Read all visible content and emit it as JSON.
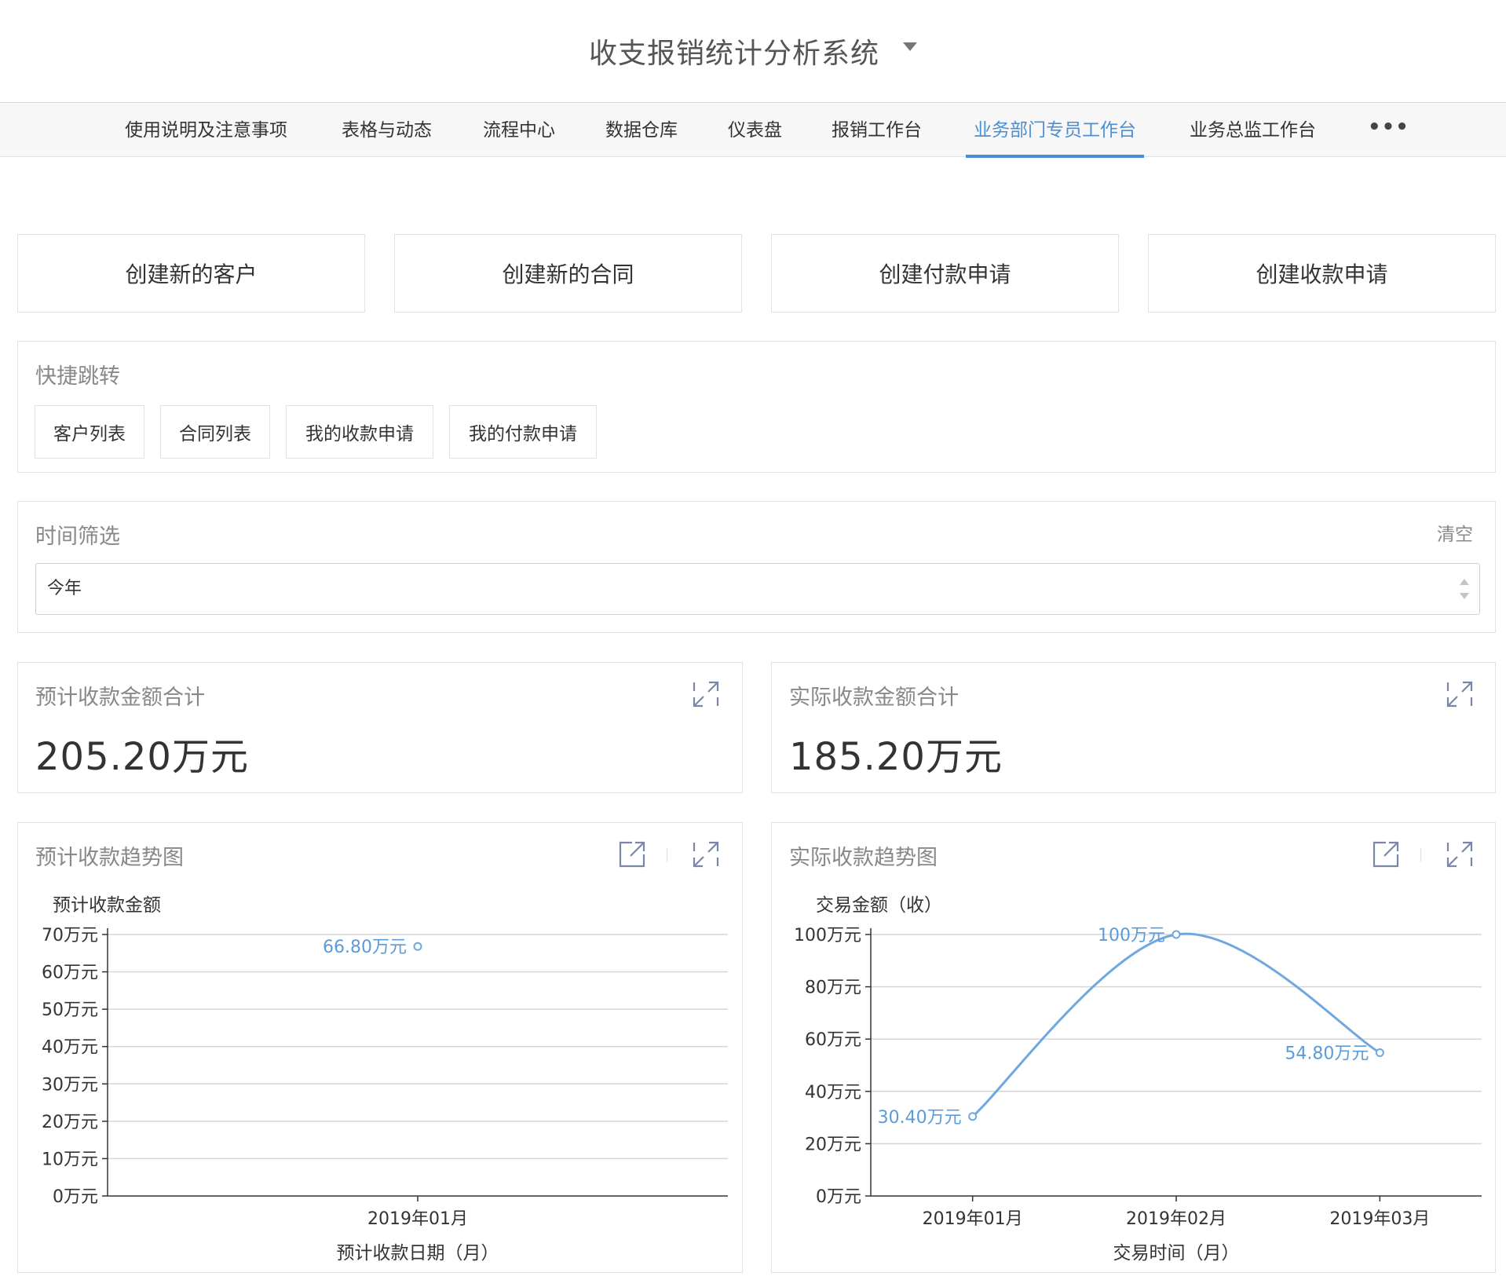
{
  "app": {
    "title": "收支报销统计分析系统"
  },
  "nav": {
    "items": [
      {
        "label": "使用说明及注意事项",
        "active": false
      },
      {
        "label": "表格与动态",
        "active": false
      },
      {
        "label": "流程中心",
        "active": false
      },
      {
        "label": "数据仓库",
        "active": false
      },
      {
        "label": "仪表盘",
        "active": false
      },
      {
        "label": "报销工作台",
        "active": false
      },
      {
        "label": "业务部门专员工作台",
        "active": true
      },
      {
        "label": "业务总监工作台",
        "active": false
      }
    ],
    "more_label": "•••"
  },
  "actions": [
    {
      "label": "创建新的客户"
    },
    {
      "label": "创建新的合同"
    },
    {
      "label": "创建付款申请"
    },
    {
      "label": "创建收款申请"
    }
  ],
  "quick_jump": {
    "title": "快捷跳转",
    "buttons": [
      {
        "label": "客户列表"
      },
      {
        "label": "合同列表"
      },
      {
        "label": "我的收款申请"
      },
      {
        "label": "我的付款申请"
      }
    ]
  },
  "time_filter": {
    "title": "时间筛选",
    "clear_label": "清空",
    "selected": "今年"
  },
  "metrics": {
    "expected": {
      "title": "预计收款金额合计",
      "value": "205.20万元"
    },
    "actual": {
      "title": "实际收款金额合计",
      "value": "185.20万元"
    }
  },
  "charts": {
    "expected_title": "预计收款趋势图",
    "actual_title": "实际收款趋势图"
  },
  "colors": {
    "accent": "#4a8fd6",
    "line": "#6fa7df",
    "label": "#5b9bd9"
  },
  "chart_data": [
    {
      "type": "scatter",
      "title": "预计收款趋势图",
      "ylabel": "预计收款金额",
      "xlabel": "预计收款日期（月）",
      "y_unit": "万元",
      "ylim": [
        0,
        70
      ],
      "yticks": [
        0,
        10,
        20,
        30,
        40,
        50,
        60,
        70
      ],
      "ytick_labels": [
        "0万元",
        "10万元",
        "20万元",
        "30万元",
        "40万元",
        "50万元",
        "60万元",
        "70万元"
      ],
      "categories": [
        "2019年01月"
      ],
      "series": [
        {
          "values": [
            66.8
          ],
          "labels": [
            "66.80万元"
          ]
        }
      ],
      "grid": true
    },
    {
      "type": "line",
      "title": "实际收款趋势图",
      "ylabel": "交易金额（收）",
      "xlabel": "交易时间（月）",
      "y_unit": "万元",
      "ylim": [
        0,
        100
      ],
      "yticks": [
        0,
        20,
        40,
        60,
        80,
        100
      ],
      "ytick_labels": [
        "0万元",
        "20万元",
        "40万元",
        "60万元",
        "80万元",
        "100万元"
      ],
      "categories": [
        "2019年01月",
        "2019年02月",
        "2019年03月"
      ],
      "series": [
        {
          "values": [
            30.4,
            100,
            54.8
          ],
          "labels": [
            "30.40万元",
            "100万元",
            "54.80万元"
          ]
        }
      ],
      "grid": true
    }
  ]
}
